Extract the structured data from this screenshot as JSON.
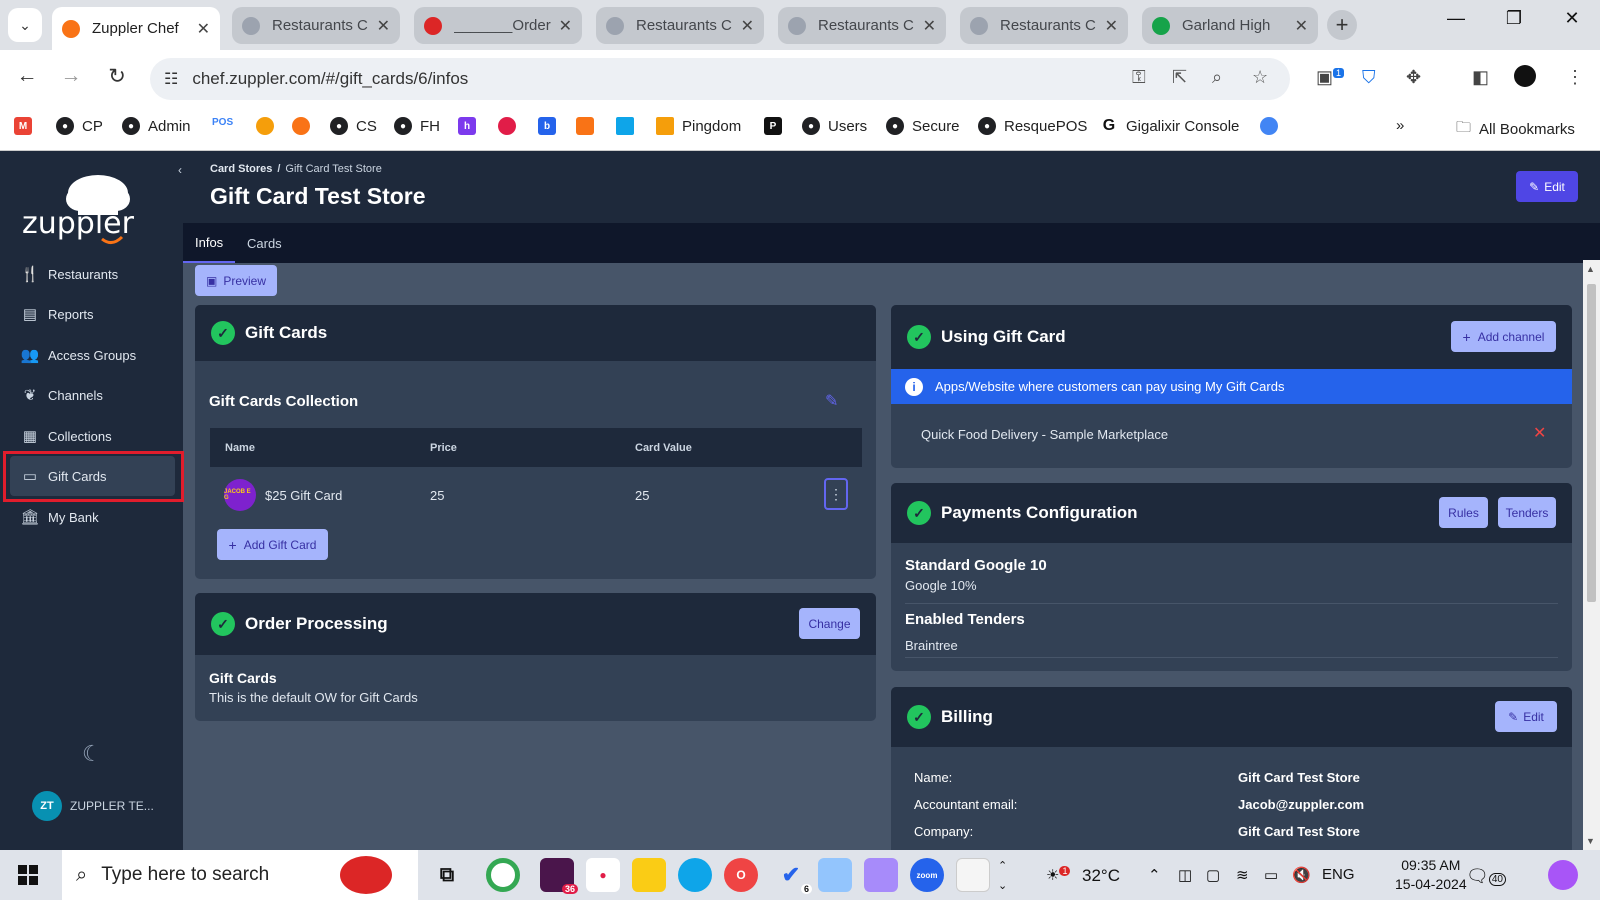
{
  "browser": {
    "tabs": [
      {
        "label": "Zuppler Chef",
        "active": true
      },
      {
        "label": "Restaurants C"
      },
      {
        "label": "_______Order"
      },
      {
        "label": "Restaurants C"
      },
      {
        "label": "Restaurants C"
      },
      {
        "label": "Restaurants C"
      },
      {
        "label": "Garland High"
      }
    ],
    "url": "chef.zuppler.com/#/gift_cards/6/infos",
    "ext_badge": "1",
    "bookmarks": [
      "CP",
      "Admin",
      "POS",
      "CS",
      "FH",
      "Pingdom",
      "Users",
      "Secure",
      "ResquePOS",
      "Gigalixir Console",
      "All Bookmarks"
    ]
  },
  "sidebar": {
    "logo_text": "zuppler",
    "items": [
      {
        "label": "Restaurants",
        "icon": "utensils-icon"
      },
      {
        "label": "Reports",
        "icon": "chart-icon"
      },
      {
        "label": "Access Groups",
        "icon": "users-icon"
      },
      {
        "label": "Channels",
        "icon": "leaf-icon"
      },
      {
        "label": "Collections",
        "icon": "images-icon"
      },
      {
        "label": "Gift Cards",
        "icon": "card-icon",
        "active": true
      },
      {
        "label": "My Bank",
        "icon": "bank-icon"
      }
    ],
    "user_initials": "ZT",
    "user_name": "ZUPPLER TE..."
  },
  "header": {
    "breadcrumb_root": "Card Stores",
    "breadcrumb_sep": "/",
    "breadcrumb_current": "Gift Card Test Store",
    "title": "Gift Card Test Store",
    "edit_label": "Edit"
  },
  "tabs": [
    "Infos",
    "Cards"
  ],
  "preview_label": "Preview",
  "gift_cards": {
    "title": "Gift Cards",
    "collection_title": "Gift Cards Collection",
    "columns": [
      "Name",
      "Price",
      "Card Value"
    ],
    "rows": [
      {
        "name": "$25 Gift Card",
        "price": "25",
        "value": "25",
        "img_text": "JACOB E G"
      }
    ],
    "add_label": "Add Gift Card"
  },
  "order_processing": {
    "title": "Order Processing",
    "change_label": "Change",
    "heading": "Gift Cards",
    "description": "This is the default OW for Gift Cards"
  },
  "using_gift_card": {
    "title": "Using Gift Card",
    "add_channel_label": "Add channel",
    "info_text": "Apps/Website where customers can pay using My Gift Cards",
    "channel": "Quick Food Delivery - Sample Marketplace"
  },
  "payments": {
    "title": "Payments Configuration",
    "rules_label": "Rules",
    "tenders_label": "Tenders",
    "standard_name": "Standard Google 10",
    "standard_desc": "Google 10%",
    "enabled_title": "Enabled Tenders",
    "enabled_value": "Braintree"
  },
  "billing": {
    "title": "Billing",
    "edit_label": "Edit",
    "fields": [
      {
        "label": "Name:",
        "value": "Gift Card Test Store"
      },
      {
        "label": "Accountant email:",
        "value": "Jacob@zuppler.com"
      },
      {
        "label": "Company:",
        "value": "Gift Card Test Store"
      }
    ]
  },
  "taskbar": {
    "search_placeholder": "Type here to search",
    "weather": "32°C",
    "weather_badge": "1",
    "lang": "ENG",
    "time": "09:35 AM",
    "date": "15-04-2024",
    "notif_count": "40",
    "slack_badge": "36",
    "todo_badge": "6"
  },
  "colors": {
    "accent": "#4f46e5",
    "success": "#22c55e",
    "info": "#2563eb",
    "danger": "#ef4444",
    "highlight": "#e11d2c"
  }
}
